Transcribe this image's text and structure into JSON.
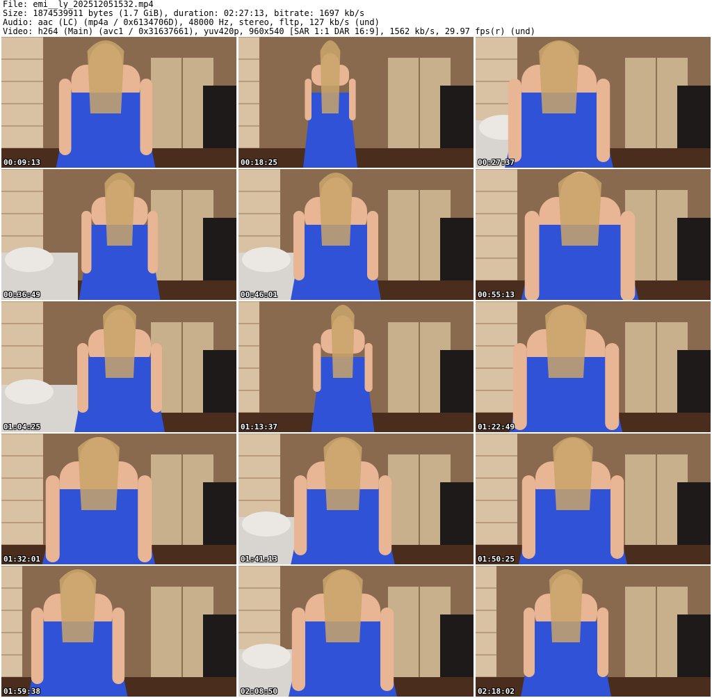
{
  "header": {
    "file_line": "File: emi__ly_202512051532.mp4",
    "size_line": "Size: 1874539911 bytes (1.7 GiB), duration: 02:27:13, bitrate: 1697 kb/s",
    "audio_line": "Audio: aac (LC) (mp4a / 0x6134706D), 48000 Hz, stereo, fltp, 127 kb/s (und)",
    "video_line": "Video: h264 (Main) (avc1 / 0x31637661), yuv420p, 960x540 [SAR 1:1 DAR 16:9], 1562 kb/s, 29.97 fps(r) (und)"
  },
  "colors": {
    "dress": "#2f52d6",
    "skin": "#e8b595",
    "wall_panel": "#d9c2a3",
    "wood": "#8a6a4f",
    "floor": "#4a2d1c"
  },
  "thumbnails": [
    {
      "timestamp": "00:09:13"
    },
    {
      "timestamp": "00:18:25"
    },
    {
      "timestamp": "00:27:37"
    },
    {
      "timestamp": "00:36:49"
    },
    {
      "timestamp": "00:46:01"
    },
    {
      "timestamp": "00:55:13"
    },
    {
      "timestamp": "01:04:25"
    },
    {
      "timestamp": "01:13:37"
    },
    {
      "timestamp": "01:22:49"
    },
    {
      "timestamp": "01:32:01"
    },
    {
      "timestamp": "01:41:13"
    },
    {
      "timestamp": "01:50:25"
    },
    {
      "timestamp": "01:59:38"
    },
    {
      "timestamp": "02:08:50"
    },
    {
      "timestamp": "02:18:02"
    }
  ]
}
